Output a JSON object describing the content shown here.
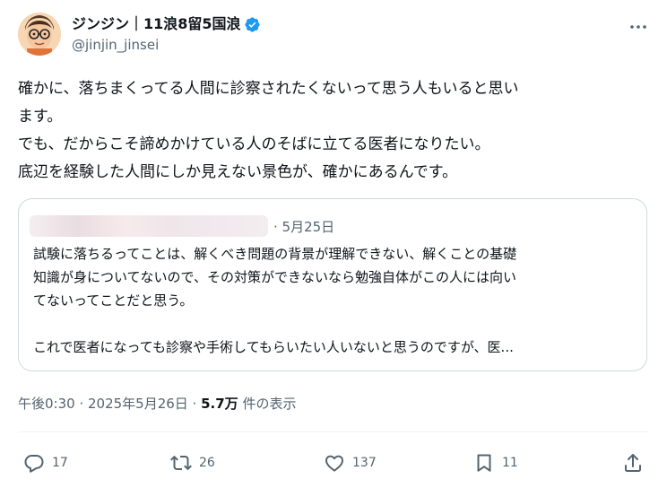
{
  "author": {
    "display_name": "ジンジン｜11浪8留5国浪",
    "handle": "@jinjin_jinsei"
  },
  "post": {
    "lines": [
      "確かに、落ちまくってる人間に診察されたくないって思う人もいると思い",
      "ます。",
      "でも、だからこそ諦めかけている人のそばに立てる医者になりたい。",
      "底辺を経験した人間にしか見えない景色が、確かにあるんです。"
    ]
  },
  "quote": {
    "date": "· 5月25日",
    "lines": [
      "試験に落ちるってことは、解くべき問題の背景が理解できない、解くことの基礎",
      "知識が身についてないので、その対策ができないなら勉強自体がこの人には向い",
      "てないってことだと思う。",
      "",
      "これで医者になっても診察や手術してもらいたい人いないと思うのですが、医..."
    ]
  },
  "meta": {
    "time": "午後0:30 · 2025年5月26日 · ",
    "views_count": "5.7万",
    "views_label": " 件の表示"
  },
  "actions": {
    "replies": "17",
    "reposts": "26",
    "likes": "137",
    "bookmarks": "11"
  },
  "colors": {
    "verified": "#1d9bf0",
    "secondary_text": "#536471",
    "border": "#cfd9de"
  },
  "icons": [
    "verified-badge-icon",
    "more-icon",
    "reply-icon",
    "repost-icon",
    "like-icon",
    "bookmark-icon",
    "share-icon"
  ]
}
